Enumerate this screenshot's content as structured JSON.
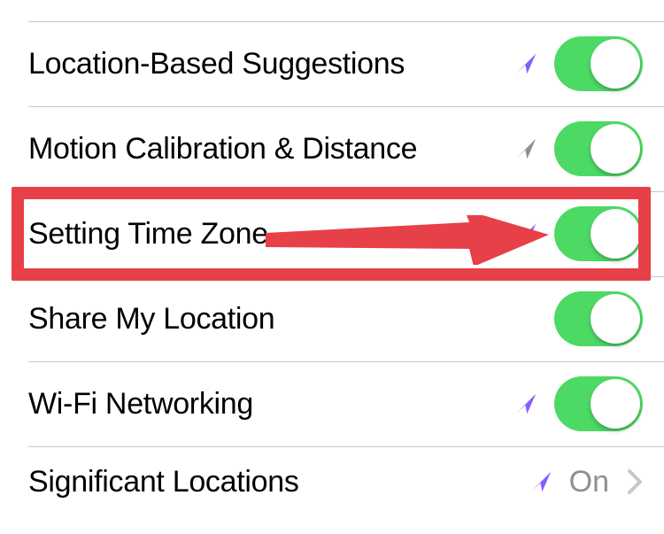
{
  "rows": [
    {
      "label": "Location-Based Suggestions",
      "icon_name": "location-arrow-icon",
      "icon_color": "purple",
      "toggle": true
    },
    {
      "label": "Motion Calibration & Distance",
      "icon_name": "location-arrow-icon",
      "icon_color": "gray",
      "toggle": true
    },
    {
      "label": "Setting Time Zone",
      "icon_name": "location-arrow-icon",
      "icon_color": "purple",
      "toggle": true,
      "highlighted": true
    },
    {
      "label": "Share My Location",
      "icon_name": null,
      "toggle": true
    },
    {
      "label": "Wi-Fi Networking",
      "icon_name": "location-arrow-icon",
      "icon_color": "purple",
      "toggle": true
    },
    {
      "label": "Significant Locations",
      "icon_name": "location-arrow-icon",
      "icon_color": "purple",
      "value": "On",
      "disclosure": true
    }
  ],
  "colors": {
    "toggle_on": "#4cd964",
    "icon_purple": "#8a5cff",
    "icon_gray": "#8e8e93",
    "annotation": "#e74049"
  }
}
